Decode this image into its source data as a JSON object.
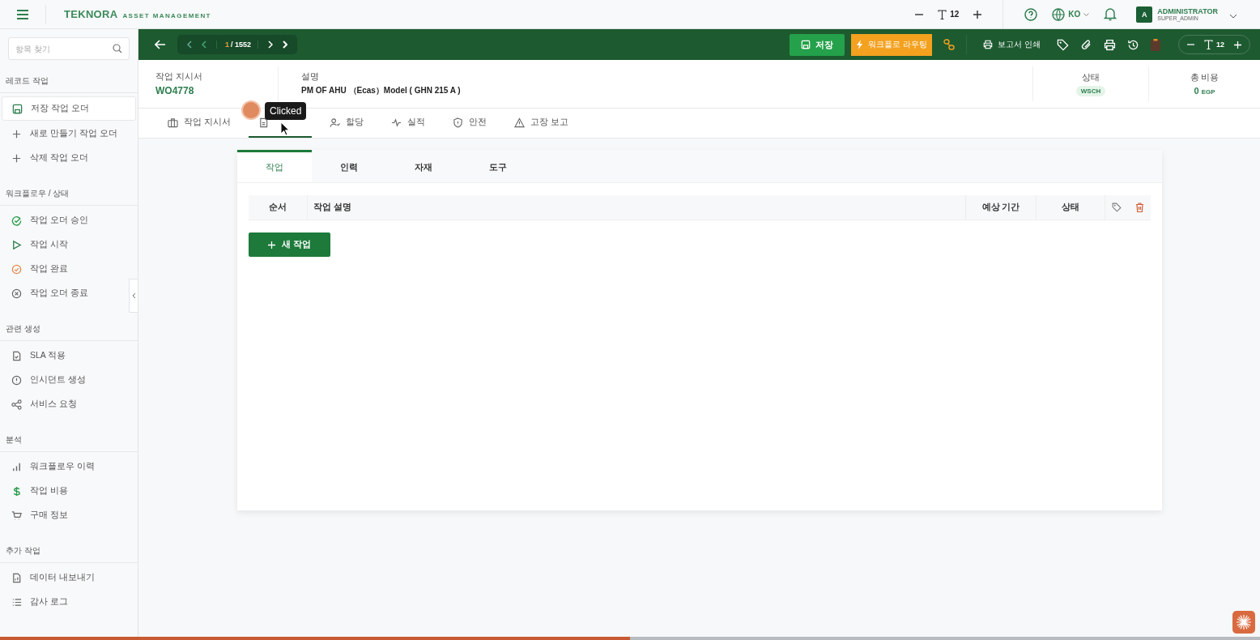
{
  "header": {
    "brand": "TEKNORA",
    "brand_sub": "ASSET MANAGEMENT",
    "font_size": "12",
    "language": "KO",
    "user": {
      "avatar": "A",
      "name": "ADMINISTRATOR",
      "role": "SUPER_ADMIN"
    }
  },
  "sidebar": {
    "search": {
      "placeholder": "항목 찾기"
    },
    "sections": [
      {
        "title": "레코드 작업",
        "items": [
          {
            "label": "저장 작업 오더",
            "selected": true
          },
          {
            "label": "새로 만들기 작업 오더",
            "selected": false
          },
          {
            "label": "삭제 작업 오더",
            "selected": false
          }
        ]
      },
      {
        "title": "워크플로우 / 상태",
        "items": [
          {
            "label": "작업 오더 승인",
            "selected": false
          },
          {
            "label": "작업 시작",
            "selected": false
          },
          {
            "label": "작업 완료",
            "selected": false
          },
          {
            "label": "작업 오더 종료",
            "selected": false
          }
        ]
      },
      {
        "title": "관련 생성",
        "items": [
          {
            "label": "SLA 적용",
            "selected": false
          },
          {
            "label": "인시던트 생성",
            "selected": false
          },
          {
            "label": "서비스 요청",
            "selected": false
          }
        ]
      },
      {
        "title": "분석",
        "items": [
          {
            "label": "워크플로우 이력",
            "selected": false
          },
          {
            "label": "작업 비용",
            "selected": false
          },
          {
            "label": "구매 정보",
            "selected": false
          }
        ]
      },
      {
        "title": "추가 작업",
        "items": [
          {
            "label": "데이터 내보내기",
            "selected": false
          },
          {
            "label": "감사 로그",
            "selected": false
          }
        ]
      }
    ]
  },
  "toolbar": {
    "pager": {
      "current": "1",
      "total": "/ 1552"
    },
    "save": "저장",
    "workflow": "워크플로 라우팅",
    "print_report": "보고서 인쇄",
    "font_size": "12"
  },
  "record": {
    "wo_label": "작업 지시서",
    "wo_value": "WO4778",
    "desc_label": "설명",
    "desc_value": "PM OF AHU （Ecas）Model ( GHN 215 A )",
    "status_label": "상태",
    "status_value": "WSCH",
    "cost_label": "총 비용",
    "cost_value": "0",
    "cost_unit": "EGP"
  },
  "tabs": [
    {
      "label": "작업 지시서",
      "selected": false
    },
    {
      "selected": true
    },
    {
      "label": "할당",
      "selected": false
    },
    {
      "label": "실적",
      "selected": false
    },
    {
      "label": "안전",
      "selected": false
    },
    {
      "label": "고장 보고",
      "selected": false
    }
  ],
  "tooltip": "Clicked",
  "subtabs": [
    {
      "label": "작업",
      "selected": true
    },
    {
      "label": "인력",
      "selected": false
    },
    {
      "label": "자재",
      "selected": false
    },
    {
      "label": "도구",
      "selected": false
    }
  ],
  "table": {
    "columns": [
      "순서",
      "작업 설명",
      "예상 기간",
      "상태"
    ]
  },
  "new_task": "새 작업",
  "progress": {
    "level": 0.5
  }
}
